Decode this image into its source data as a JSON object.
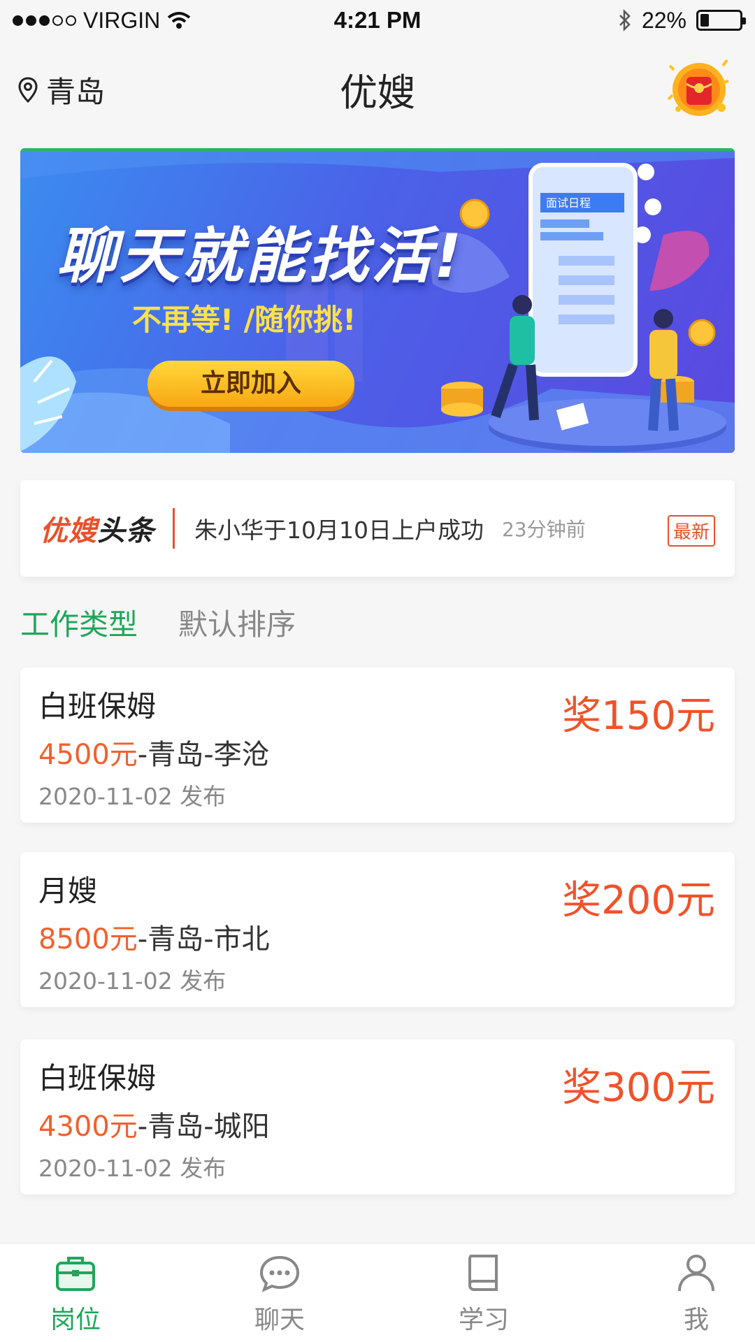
{
  "status_bar": {
    "carrier": "VIRGIN",
    "time": "4:21 PM",
    "battery": "22%",
    "battery_level": 0.22
  },
  "header": {
    "city": "青岛",
    "title": "优嫂"
  },
  "banner": {
    "headline": "聊天就能找活!",
    "subline": "不再等! /随你挑!",
    "button_label": "立即加入",
    "phone_caption": "面试日程"
  },
  "news": {
    "brand_red": "优嫂",
    "brand_dark": "头条",
    "text": "朱小华于10月10日上户成功",
    "time": "23分钟前",
    "tag": "最新"
  },
  "filters": {
    "job_type": "工作类型",
    "default_sort": "默认排序"
  },
  "jobs": [
    {
      "title": "白班保姆",
      "salary": "4500元",
      "location": "-青岛-李沧",
      "date": "2020-11-02 发布",
      "bonus": "奖150元"
    },
    {
      "title": "月嫂",
      "salary": "8500元",
      "location": "-青岛-市北",
      "date": "2020-11-02 发布",
      "bonus": "奖200元"
    },
    {
      "title": "白班保姆",
      "salary": "4300元",
      "location": "-青岛-城阳",
      "date": "2020-11-02 发布",
      "bonus": "奖300元"
    }
  ],
  "tabs": [
    {
      "label": "岗位",
      "icon": "briefcase-icon",
      "active": true
    },
    {
      "label": "聊天",
      "icon": "chat-bubble-icon",
      "active": false
    },
    {
      "label": "学习",
      "icon": "book-icon",
      "active": false
    },
    {
      "label": "我",
      "icon": "person-icon",
      "active": false
    }
  ],
  "colors": {
    "accent_green": "#1ea65b",
    "accent_orange": "#f0522a"
  }
}
